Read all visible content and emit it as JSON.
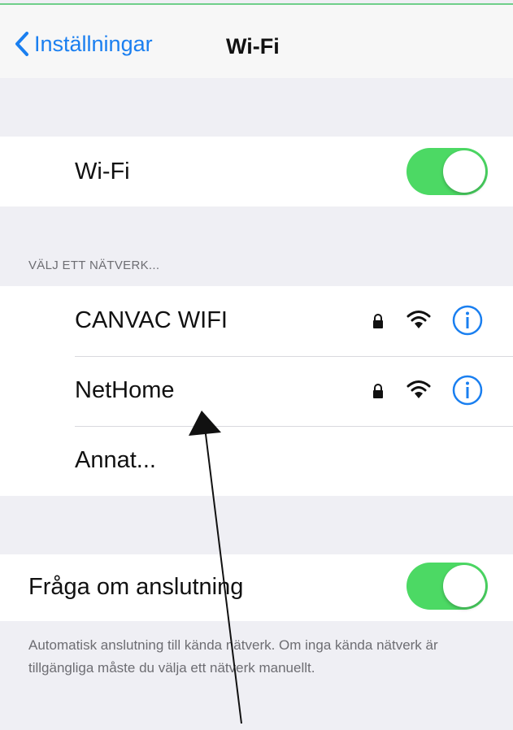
{
  "navbar": {
    "back_label": "Inställningar",
    "title": "Wi-Fi"
  },
  "wifi": {
    "label": "Wi-Fi",
    "enabled": true
  },
  "networks": {
    "header": "VÄLJ ETT NÄTVERK...",
    "items": [
      {
        "name": "CANVAC WIFI",
        "secured": true,
        "icons": [
          "lock-icon",
          "wifi-signal-icon",
          "info-icon"
        ]
      },
      {
        "name": "NetHome",
        "secured": true,
        "icons": [
          "lock-icon",
          "wifi-signal-icon",
          "info-icon"
        ]
      }
    ],
    "other_label": "Annat..."
  },
  "ask_to_join": {
    "label": "Fråga om anslutning",
    "enabled": true,
    "description": "Automatisk anslutning till kända nätverk. Om inga kända nätverk är tillgängliga måste du välja ett nätverk manuellt."
  },
  "colors": {
    "accent": "#1a7ff0",
    "toggle_on": "#4cd964",
    "background": "#efeff4"
  }
}
